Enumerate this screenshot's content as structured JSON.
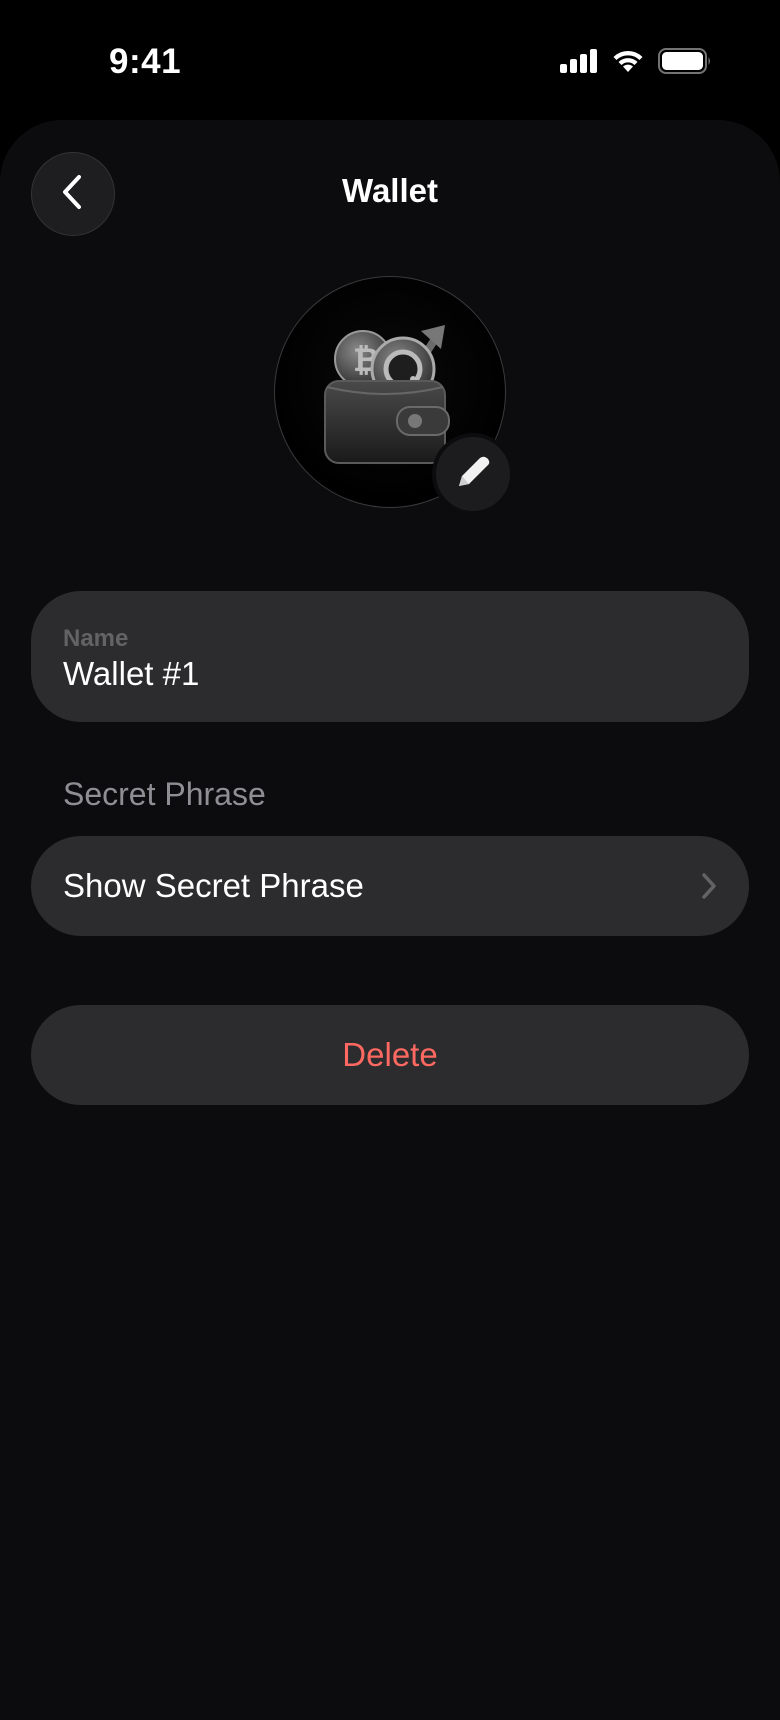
{
  "status_bar": {
    "time": "9:41",
    "icons": [
      "cellular-signal-icon",
      "wifi-icon",
      "battery-icon"
    ]
  },
  "header": {
    "title": "Wallet",
    "back_icon": "chevron-left-icon"
  },
  "avatar": {
    "image": "wallet-coins-icon",
    "edit_icon": "pencil-icon"
  },
  "name_field": {
    "label": "Name",
    "value": "Wallet #1"
  },
  "secret_section": {
    "header": "Secret Phrase",
    "row_label": "Show Secret Phrase",
    "row_icon": "chevron-right-icon"
  },
  "delete": {
    "label": "Delete",
    "color": "#ff6961"
  },
  "colors": {
    "background": "#000000",
    "sheet": "#0c0c0e",
    "card": "#2c2c2e",
    "secondary_text": "#8e8e93"
  }
}
